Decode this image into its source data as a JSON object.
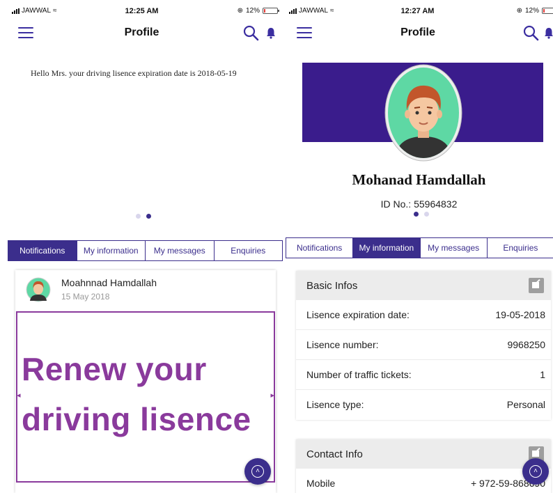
{
  "status_left": {
    "carrier": "JAWWAL",
    "time": "12:25 AM",
    "battery": "12%"
  },
  "status_right": {
    "carrier": "JAWWAL",
    "time": "12:27 AM",
    "battery": "12%"
  },
  "battery_level": 0.12,
  "navbar": {
    "title": "Profile"
  },
  "left": {
    "notice": "Hello Mrs. your driving lisence expiration date is 2018-05-19",
    "carousel": {
      "count": 2,
      "active_index": 1
    },
    "tabs": [
      {
        "label": "Notifications",
        "active": true
      },
      {
        "label": "My information",
        "active": false
      },
      {
        "label": "My messages",
        "active": false
      },
      {
        "label": "Enquiries",
        "active": false
      }
    ],
    "notification": {
      "author": "Moahnnad Hamdallah",
      "date": "15 May 2018",
      "promo_line1": "Renew your",
      "promo_line2": "driving lisence"
    }
  },
  "right": {
    "profile": {
      "name": "Mohanad Hamdallah",
      "id": "ID No.: 55964832"
    },
    "carousel": {
      "count": 2,
      "active_index": 0
    },
    "tabs": [
      {
        "label": "Notifications",
        "active": false
      },
      {
        "label": "My information",
        "active": true
      },
      {
        "label": "My messages",
        "active": false
      },
      {
        "label": "Enquiries",
        "active": false
      }
    ],
    "basic_infos": {
      "title": "Basic Infos",
      "rows": [
        {
          "label": "Lisence expiration date:",
          "value": "19-05-2018"
        },
        {
          "label": "Lisence number:",
          "value": "9968250"
        },
        {
          "label": "Number of traffic tickets:",
          "value": "1"
        },
        {
          "label": "Lisence type:",
          "value": "Personal"
        }
      ]
    },
    "contact_info": {
      "title": "Contact Info",
      "rows": [
        {
          "label": "Mobile",
          "value": "+ 972-59-868690"
        }
      ]
    }
  },
  "colors": {
    "primary": "#3b2e8c",
    "banner": "#3a1c8c",
    "promo": "#8a3a9c",
    "avatar_bg": "#5ed8a4",
    "hair": "#c2562b"
  },
  "icons": [
    "menu-icon",
    "search-icon",
    "bell-icon",
    "signal-icon",
    "wifi-icon",
    "battery-icon",
    "edit-icon",
    "scroll-top-icon"
  ]
}
